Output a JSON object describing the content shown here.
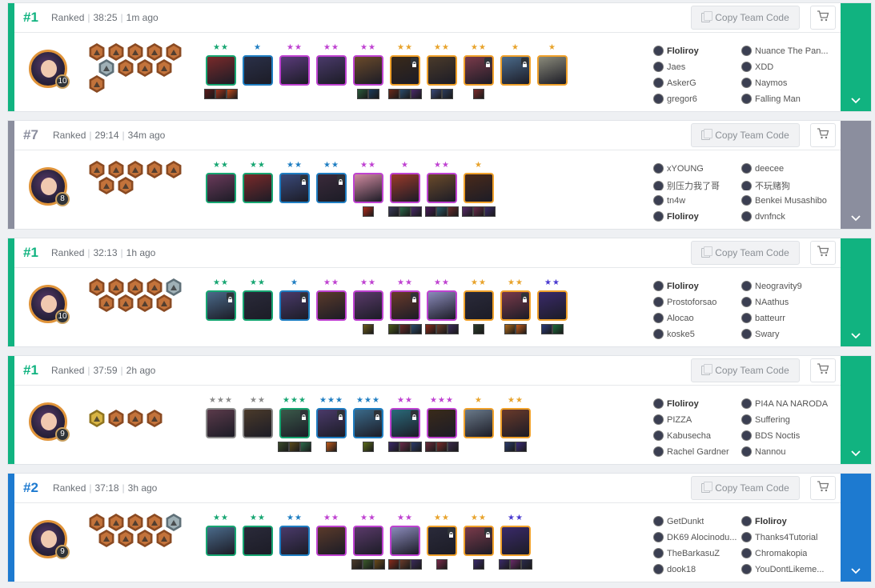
{
  "colors": {
    "first": "#11b380",
    "seventh": "#8b8e9e",
    "second": "#1d7ad0",
    "star1": "#e8a32c",
    "star2": "#c54fd6",
    "star3": "#1f6fc2",
    "cost_border": [
      "#8a8a8a",
      "#17a672",
      "#1f7ec2",
      "#bf42d1",
      "#f0a12b"
    ]
  },
  "ui": {
    "copy_label": "Copy Team Code",
    "copy_icon": "copy-icon",
    "cart_icon": "cart-icon",
    "expand_icon": "chevron-down-icon",
    "mode": "Ranked"
  },
  "matches": [
    {
      "place": "#1",
      "color": "#11b380",
      "duration": "38:25",
      "ago": "1m ago",
      "level": "10",
      "traits": [
        {
          "tier": "bronze",
          "icon": "trait-icon"
        },
        {
          "tier": "bronze",
          "icon": "trait-icon"
        },
        {
          "tier": "bronze",
          "icon": "trait-icon"
        },
        {
          "tier": "bronze",
          "icon": "trait-icon"
        },
        {
          "tier": "bronze",
          "icon": "trait-icon"
        },
        {
          "tier": "silver",
          "icon": "trait-icon"
        },
        {
          "tier": "bronze",
          "icon": "trait-icon"
        },
        {
          "tier": "bronze",
          "icon": "trait-icon"
        },
        {
          "tier": "bronze",
          "icon": "trait-icon"
        },
        {
          "tier": "bronze",
          "icon": "trait-icon"
        }
      ],
      "units": [
        {
          "stars": "★★",
          "sc": "#17a672",
          "cost": 1,
          "color": "#7a2a2a",
          "items": [
            "#5a1a1a",
            "#a0341d",
            "#c04a1a"
          ],
          "lock": false
        },
        {
          "stars": "★",
          "sc": "#1f7ec2",
          "cost": 2,
          "color": "#2a3048",
          "items": [],
          "lock": false
        },
        {
          "stars": "★★",
          "sc": "#bf42d1",
          "cost": 3,
          "color": "#5a3b7a",
          "items": [],
          "lock": false
        },
        {
          "stars": "★★",
          "sc": "#bf42d1",
          "cost": 3,
          "color": "#4a3a6a",
          "items": [],
          "lock": false
        },
        {
          "stars": "★★",
          "sc": "#bf42d1",
          "cost": 3,
          "color": "#6a4a2a",
          "items": [
            "#2a5a3a",
            "#1a3a5a"
          ],
          "lock": false
        },
        {
          "stars": "★★",
          "sc": "#e8a32c",
          "cost": 4,
          "color": "#3a2a1a",
          "items": [
            "#6a2a1a",
            "#2a4a6a",
            "#4a2a6a"
          ],
          "lock": true
        },
        {
          "stars": "★★",
          "sc": "#e8a32c",
          "cost": 4,
          "color": "#4a3a2a",
          "items": [
            "#3a4a7a",
            "#2a3a5a"
          ],
          "lock": false
        },
        {
          "stars": "★★",
          "sc": "#e8a32c",
          "cost": 4,
          "color": "#7a3a4a",
          "items": [
            "#7a2a2a"
          ],
          "lock": true
        },
        {
          "stars": "★",
          "sc": "#e8a32c",
          "cost": 4,
          "color": "#4a6a8a",
          "items": [],
          "lock": true
        },
        {
          "stars": "★",
          "sc": "#e8a32c",
          "cost": 4,
          "color": "#8a8a7a",
          "items": [],
          "lock": false
        }
      ],
      "players": [
        {
          "name": "Floliroy",
          "me": true
        },
        {
          "name": "Nuance The Pan...",
          "me": false
        },
        {
          "name": "Jaes",
          "me": false
        },
        {
          "name": "XDD",
          "me": false
        },
        {
          "name": "AskerG",
          "me": false
        },
        {
          "name": "Naymos",
          "me": false
        },
        {
          "name": "gregor6",
          "me": false
        },
        {
          "name": "Falling Man",
          "me": false
        }
      ]
    },
    {
      "place": "#7",
      "color": "#8b8e9e",
      "duration": "29:14",
      "ago": "34m ago",
      "level": "8",
      "traits": [
        {
          "tier": "bronze",
          "icon": "trait-icon"
        },
        {
          "tier": "bronze",
          "icon": "trait-icon"
        },
        {
          "tier": "bronze",
          "icon": "trait-icon"
        },
        {
          "tier": "bronze",
          "icon": "trait-icon"
        },
        {
          "tier": "bronze",
          "icon": "trait-icon"
        },
        {
          "tier": "bronze",
          "icon": "trait-icon"
        },
        {
          "tier": "bronze",
          "icon": "trait-icon"
        }
      ],
      "units": [
        {
          "stars": "★★",
          "sc": "#17a672",
          "cost": 1,
          "color": "#6a3a5a",
          "items": [],
          "lock": false
        },
        {
          "stars": "★★",
          "sc": "#17a672",
          "cost": 1,
          "color": "#7a2a2a",
          "items": [],
          "lock": false
        },
        {
          "stars": "★★",
          "sc": "#1f7ec2",
          "cost": 2,
          "color": "#3a4a7a",
          "items": [],
          "lock": true
        },
        {
          "stars": "★★",
          "sc": "#1f7ec2",
          "cost": 2,
          "color": "#3a2a3a",
          "items": [],
          "lock": true
        },
        {
          "stars": "★★",
          "sc": "#bf42d1",
          "cost": 3,
          "color": "#d08aa0",
          "items": [
            "#b02a1a"
          ],
          "lock": false
        },
        {
          "stars": "★",
          "sc": "#bf42d1",
          "cost": 3,
          "color": "#9a3a2a",
          "items": [
            "#3a3a5a",
            "#2a6a4a",
            "#4a2a6a"
          ],
          "lock": false
        },
        {
          "stars": "★★",
          "sc": "#bf42d1",
          "cost": 3,
          "color": "#6a4a2a",
          "items": [
            "#4a1a5a",
            "#2a5a6a",
            "#6a2a2a"
          ],
          "lock": false
        },
        {
          "stars": "★",
          "sc": "#e8a32c",
          "cost": 4,
          "color": "#4a2a1a",
          "items": [
            "#5a2a6a",
            "#6a2a4a",
            "#3a2a6a"
          ],
          "lock": false
        }
      ],
      "players": [
        {
          "name": "xYOUNG",
          "me": false
        },
        {
          "name": "deecee",
          "me": false
        },
        {
          "name": "别压力我了哥",
          "me": false
        },
        {
          "name": "不玩赌狗",
          "me": false
        },
        {
          "name": "tn4w",
          "me": false
        },
        {
          "name": "Benkei Musashibo",
          "me": false
        },
        {
          "name": "Floliroy",
          "me": true
        },
        {
          "name": "dvnfnck",
          "me": false
        }
      ]
    },
    {
      "place": "#1",
      "color": "#11b380",
      "duration": "32:13",
      "ago": "1h ago",
      "level": "10",
      "traits": [
        {
          "tier": "bronze",
          "icon": "trait-icon"
        },
        {
          "tier": "bronze",
          "icon": "trait-icon"
        },
        {
          "tier": "bronze",
          "icon": "trait-icon"
        },
        {
          "tier": "bronze",
          "icon": "trait-icon"
        },
        {
          "tier": "silver",
          "icon": "trait-icon"
        },
        {
          "tier": "bronze",
          "icon": "trait-icon"
        },
        {
          "tier": "bronze",
          "icon": "trait-icon"
        },
        {
          "tier": "bronze",
          "icon": "trait-icon"
        },
        {
          "tier": "bronze",
          "icon": "trait-icon"
        }
      ],
      "units": [
        {
          "stars": "★★",
          "sc": "#17a672",
          "cost": 1,
          "color": "#4a6a8a",
          "items": [],
          "lock": true
        },
        {
          "stars": "★★",
          "sc": "#17a672",
          "cost": 1,
          "color": "#2a2a3a",
          "items": [],
          "lock": false
        },
        {
          "stars": "★",
          "sc": "#1f7ec2",
          "cost": 2,
          "color": "#4a3a6a",
          "items": [],
          "lock": true
        },
        {
          "stars": "★★",
          "sc": "#bf42d1",
          "cost": 3,
          "color": "#5a3a2a",
          "items": [],
          "lock": false
        },
        {
          "stars": "★★",
          "sc": "#bf42d1",
          "cost": 3,
          "color": "#5a3a6a",
          "items": [
            "#6a5a1a"
          ],
          "lock": false
        },
        {
          "stars": "★★",
          "sc": "#bf42d1",
          "cost": 3,
          "color": "#6a3a2a",
          "items": [
            "#4a5a1a",
            "#6a2a2a",
            "#2a4a6a"
          ],
          "lock": true
        },
        {
          "stars": "★★",
          "sc": "#bf42d1",
          "cost": 3,
          "color": "#8a8aba",
          "items": [
            "#8a2a1a",
            "#6a3a2a",
            "#3a2a5a"
          ],
          "lock": false
        },
        {
          "stars": "★★",
          "sc": "#e8a32c",
          "cost": 4,
          "color": "#2a2a3a",
          "items": [
            "#2a3a2a"
          ],
          "lock": false
        },
        {
          "stars": "★★",
          "sc": "#e8a32c",
          "cost": 4,
          "color": "#7a3a4a",
          "items": [
            "#b06a1a",
            "#c05a1a"
          ],
          "lock": true
        },
        {
          "stars": "★★",
          "sc": "#4a3ad0",
          "cost": 4,
          "color": "#3a2a6a",
          "items": [
            "#2a3a7a",
            "#1a6a3a"
          ],
          "lock": false
        }
      ],
      "players": [
        {
          "name": "Floliroy",
          "me": true
        },
        {
          "name": "Neogravity9",
          "me": false
        },
        {
          "name": "Prostoforsao",
          "me": false
        },
        {
          "name": "NAathus",
          "me": false
        },
        {
          "name": "Alocao",
          "me": false
        },
        {
          "name": "batteurr",
          "me": false
        },
        {
          "name": "koske5",
          "me": false
        },
        {
          "name": "Swary",
          "me": false
        }
      ]
    },
    {
      "place": "#1",
      "color": "#11b380",
      "duration": "37:59",
      "ago": "2h ago",
      "level": "9",
      "traits": [
        {
          "tier": "gold",
          "icon": "trait-icon"
        },
        {
          "tier": "bronze",
          "icon": "trait-icon"
        },
        {
          "tier": "bronze",
          "icon": "trait-icon"
        },
        {
          "tier": "bronze",
          "icon": "trait-icon"
        }
      ],
      "units": [
        {
          "stars": "★★★",
          "sc": "#8a8a8a",
          "cost": 0,
          "color": "#5a3a4a",
          "items": [],
          "lock": false
        },
        {
          "stars": "★★",
          "sc": "#8a8a8a",
          "cost": 0,
          "color": "#4a3a2a",
          "items": [],
          "lock": false
        },
        {
          "stars": "★★★",
          "sc": "#17a672",
          "cost": 1,
          "color": "#3a5a4a",
          "items": [
            "#3a4a2a",
            "#5a4a1a",
            "#2a6a4a"
          ],
          "lock": true
        },
        {
          "stars": "★★★",
          "sc": "#1f7ec2",
          "cost": 2,
          "color": "#4a3a6a",
          "items": [
            "#c05a1a"
          ],
          "lock": true
        },
        {
          "stars": "★★★",
          "sc": "#1f7ec2",
          "cost": 2,
          "color": "#3a6a8a",
          "items": [
            "#5a6a1a"
          ],
          "lock": true
        },
        {
          "stars": "★★",
          "sc": "#bf42d1",
          "cost": 3,
          "color": "#2a6a7a",
          "items": [
            "#3a2a6a",
            "#6a2a4a",
            "#2a3a6a"
          ],
          "lock": true
        },
        {
          "stars": "★★★",
          "sc": "#bf42d1",
          "cost": 3,
          "color": "#3a2a1a",
          "items": [
            "#6a2a3a",
            "#7a2a2a",
            "#3a2a4a"
          ],
          "lock": false
        },
        {
          "stars": "★",
          "sc": "#e8a32c",
          "cost": 4,
          "color": "#6a7a8a",
          "items": [],
          "lock": false
        },
        {
          "stars": "★★",
          "sc": "#e8a32c",
          "cost": 4,
          "color": "#6a3a2a",
          "items": [
            "#2a3a6a",
            "#3a2a7a"
          ],
          "lock": false
        }
      ],
      "players": [
        {
          "name": "Floliroy",
          "me": true
        },
        {
          "name": "PI4A NA NARODA",
          "me": false
        },
        {
          "name": "PIZZA",
          "me": false
        },
        {
          "name": "Suffering",
          "me": false
        },
        {
          "name": "Kabusecha",
          "me": false
        },
        {
          "name": "BDS Noctis",
          "me": false
        },
        {
          "name": "Rachel Gardner",
          "me": false
        },
        {
          "name": "Nannou",
          "me": false
        }
      ]
    },
    {
      "place": "#2",
      "color": "#1d7ad0",
      "duration": "37:18",
      "ago": "3h ago",
      "level": "9",
      "traits": [
        {
          "tier": "bronze",
          "icon": "trait-icon"
        },
        {
          "tier": "bronze",
          "icon": "trait-icon"
        },
        {
          "tier": "bronze",
          "icon": "trait-icon"
        },
        {
          "tier": "bronze",
          "icon": "trait-icon"
        },
        {
          "tier": "silver",
          "icon": "trait-icon"
        },
        {
          "tier": "bronze",
          "icon": "trait-icon"
        },
        {
          "tier": "bronze",
          "icon": "trait-icon"
        },
        {
          "tier": "bronze",
          "icon": "trait-icon"
        },
        {
          "tier": "bronze",
          "icon": "trait-icon"
        }
      ],
      "units": [
        {
          "stars": "★★",
          "sc": "#17a672",
          "cost": 1,
          "color": "#4a6a8a",
          "items": [],
          "lock": false
        },
        {
          "stars": "★★",
          "sc": "#17a672",
          "cost": 1,
          "color": "#2a2a3a",
          "items": [],
          "lock": false
        },
        {
          "stars": "★★",
          "sc": "#1f7ec2",
          "cost": 2,
          "color": "#4a3a6a",
          "items": [],
          "lock": false
        },
        {
          "stars": "★★",
          "sc": "#bf42d1",
          "cost": 3,
          "color": "#5a3a2a",
          "items": [],
          "lock": false
        },
        {
          "stars": "★★",
          "sc": "#bf42d1",
          "cost": 3,
          "color": "#5a3a6a",
          "items": [
            "#4a3a2a",
            "#3a5a2a",
            "#6a4a1a"
          ],
          "lock": false
        },
        {
          "stars": "★★",
          "sc": "#bf42d1",
          "cost": 3,
          "color": "#8a8aba",
          "items": [
            "#8a2a1a",
            "#6a3a2a",
            "#3a2a5a"
          ],
          "lock": false
        },
        {
          "stars": "★★",
          "sc": "#e8a32c",
          "cost": 4,
          "color": "#2a2a3a",
          "items": [
            "#7a2a4a"
          ],
          "lock": true
        },
        {
          "stars": "★★",
          "sc": "#e8a32c",
          "cost": 4,
          "color": "#7a3a4a",
          "items": [
            "#3a2a6a"
          ],
          "lock": true
        },
        {
          "stars": "★★",
          "sc": "#4a3ad0",
          "cost": 4,
          "color": "#3a2a6a",
          "items": [
            "#3a2a6a",
            "#6a2a6a",
            "#2a2a4a"
          ],
          "lock": false
        }
      ],
      "players": [
        {
          "name": "GetDunkt",
          "me": false
        },
        {
          "name": "Floliroy",
          "me": true
        },
        {
          "name": "DK69 Alocinodu...",
          "me": false
        },
        {
          "name": "Thanks4Tutorial",
          "me": false
        },
        {
          "name": "TheBarkasuZ",
          "me": false
        },
        {
          "name": "Chromakopia",
          "me": false
        },
        {
          "name": "dook18",
          "me": false
        },
        {
          "name": "YouDontLikeme...",
          "me": false
        }
      ]
    }
  ]
}
